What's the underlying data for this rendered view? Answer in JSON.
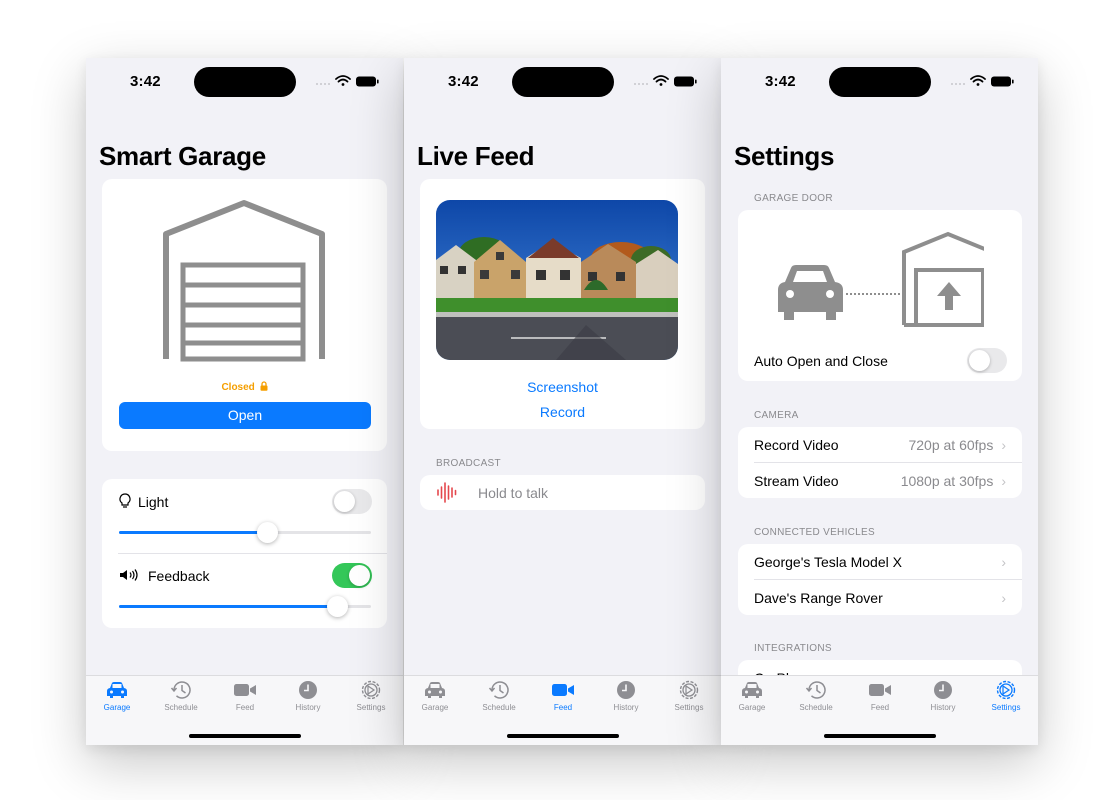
{
  "status": {
    "time": "3:42"
  },
  "tabs": [
    {
      "label": "Garage",
      "icon": "car-icon"
    },
    {
      "label": "Schedule",
      "icon": "history-clock-icon"
    },
    {
      "label": "Feed",
      "icon": "video-icon"
    },
    {
      "label": "History",
      "icon": "clock-icon"
    },
    {
      "label": "Settings",
      "icon": "gear-icon"
    }
  ],
  "garage": {
    "title": "Smart Garage",
    "status_label": "Closed",
    "status_color": "#f59f00",
    "open_button": "Open",
    "light": {
      "label": "Light",
      "on": false,
      "level": 0.59
    },
    "feedback": {
      "label": "Feedback",
      "on": true,
      "level": 0.87
    }
  },
  "feed": {
    "title": "Live Feed",
    "screenshot_label": "Screenshot",
    "record_label": "Record",
    "broadcast_header": "BROADCAST",
    "hold_to_talk": "Hold to talk"
  },
  "settings": {
    "title": "Settings",
    "garage_door_header": "GARAGE DOOR",
    "auto_open_label": "Auto Open and Close",
    "auto_open_on": false,
    "camera_header": "CAMERA",
    "camera_rows": [
      {
        "label": "Record Video",
        "value": "720p at 60fps"
      },
      {
        "label": "Stream Video",
        "value": "1080p at 30fps"
      }
    ],
    "vehicles_header": "CONNECTED VEHICLES",
    "vehicles": [
      {
        "label": "George's Tesla Model X"
      },
      {
        "label": "Dave's Range Rover"
      }
    ],
    "integrations_header": "INTEGRATIONS",
    "integrations": [
      {
        "label": "CarPlay"
      }
    ]
  },
  "colors": {
    "accent": "#0a7aff",
    "toggle_on": "#34c759",
    "broadcast_wave": "#e5484d"
  }
}
